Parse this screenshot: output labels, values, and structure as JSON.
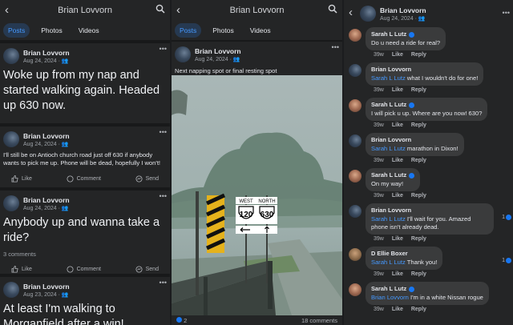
{
  "panel1": {
    "header_title": "Brian Lovvorn",
    "tabs": [
      {
        "label": "Posts",
        "active": true
      },
      {
        "label": "Photos",
        "active": false
      },
      {
        "label": "Videos",
        "active": false
      }
    ],
    "posts": [
      {
        "author": "Brian Lovvorn",
        "date": "Aug 24, 2024 · ",
        "text": "Woke up from my nap and started walking again. Headed up 630 now.",
        "comments": ""
      },
      {
        "author": "Brian Lovvorn",
        "date": "Aug 24, 2024 · ",
        "text": "I'll still be on Antioch church road just off 630 if anybody wants to pick me up. Phone will be dead, hopefully I won't!",
        "comments": ""
      },
      {
        "author": "Brian Lovvorn",
        "date": "Aug 24, 2024 · ",
        "text": "Anybody up and wanna take a ride?",
        "comments": "3 comments"
      },
      {
        "author": "Brian Lovvorn",
        "date": "Aug 23, 2024 · ",
        "text": "At least I'm walking to Morganfield after a win!",
        "comments": ""
      }
    ],
    "actions": {
      "like": "Like",
      "comment": "Comment",
      "send": "Send"
    }
  },
  "panel2": {
    "header_title": "Brian Lovvorn",
    "tabs": [
      {
        "label": "Posts",
        "active": true
      },
      {
        "label": "Photos",
        "active": false
      },
      {
        "label": "Videos",
        "active": false
      }
    ],
    "post": {
      "author": "Brian Lovvorn",
      "date": "Aug 24, 2024 · ",
      "text": "Next napping spot or final resting spot"
    },
    "signs": {
      "left_top": "WEST",
      "left_num": "120",
      "right_top": "NORTH",
      "right_num": "630"
    },
    "footer": {
      "reactions": "2",
      "comments": "18 comments"
    }
  },
  "panel3": {
    "header_title": "Brian Lovvorn",
    "header_date": "Aug 24, 2024 · ",
    "comments": [
      {
        "author": "Sarah L Lutz",
        "verified": true,
        "mention": "",
        "text": "Do u need a ride for real?",
        "time": "39w",
        "like": "Like",
        "reply": "Reply",
        "likes": "",
        "avatar": "sarah"
      },
      {
        "author": "Brian Lovvorn",
        "verified": false,
        "mention": "Sarah L Lutz",
        "text": " what I wouldn't do for one!",
        "time": "39w",
        "like": "Like",
        "reply": "Reply",
        "likes": "",
        "avatar": "brian"
      },
      {
        "author": "Sarah L Lutz",
        "verified": true,
        "mention": "",
        "text": "I will pick u up. Where are you now! 630?",
        "time": "39w",
        "like": "Like",
        "reply": "Reply",
        "likes": "",
        "avatar": "sarah"
      },
      {
        "author": "Brian Lovvorn",
        "verified": false,
        "mention": "Sarah L Lutz",
        "text": " marathon in Dixon!",
        "time": "39w",
        "like": "Like",
        "reply": "Reply",
        "likes": "",
        "avatar": "brian"
      },
      {
        "author": "Sarah L Lutz",
        "verified": true,
        "mention": "",
        "text": "On my way!",
        "time": "39w",
        "like": "Like",
        "reply": "Reply",
        "likes": "",
        "avatar": "sarah"
      },
      {
        "author": "Brian Lovvorn",
        "verified": false,
        "mention": "Sarah L Lutz",
        "text": " I'll wait for you. Amazed phone isn't already dead.",
        "time": "39w",
        "like": "Like",
        "reply": "Reply",
        "likes": "1",
        "avatar": "brian"
      },
      {
        "author": "D Ellie Boxer",
        "verified": false,
        "mention": "Sarah L Lutz",
        "text": " Thank you!",
        "time": "39w",
        "like": "Like",
        "reply": "Reply",
        "likes": "1",
        "avatar": "ellie"
      },
      {
        "author": "Sarah L Lutz",
        "verified": true,
        "mention": "Brian Lovvorn",
        "text": " I'm in a white Nissan rogue",
        "time": "39w",
        "like": "Like",
        "reply": "Reply",
        "likes": "",
        "avatar": "sarah"
      }
    ]
  },
  "colors": {
    "bg": "#242526",
    "accent": "#4599ff",
    "bubble": "#3a3b3c",
    "verified": "#1877f2"
  }
}
